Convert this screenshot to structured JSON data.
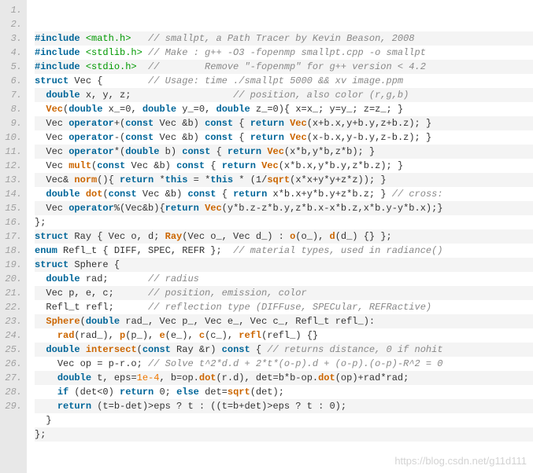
{
  "watermark": "https://blog.csdn.net/g11d111",
  "lines": [
    {
      "n": "1.",
      "pre": "",
      "tokens": [
        [
          "kw",
          "#include "
        ],
        [
          "inc",
          "<math.h>"
        ],
        [
          "plain",
          "   "
        ],
        [
          "cm",
          "// smallpt, a Path Tracer by Kevin Beason, 2008"
        ]
      ],
      "hl": true
    },
    {
      "n": "2.",
      "pre": "",
      "tokens": [
        [
          "kw",
          "#include "
        ],
        [
          "inc",
          "<stdlib.h>"
        ],
        [
          "plain",
          " "
        ],
        [
          "cm",
          "// Make : g++ -O3 -fopenmp smallpt.cpp -o smallpt"
        ]
      ]
    },
    {
      "n": "3.",
      "pre": "",
      "tokens": [
        [
          "kw",
          "#include "
        ],
        [
          "inc",
          "<stdio.h>"
        ],
        [
          "plain",
          "  "
        ],
        [
          "cm",
          "//        Remove \"-fopenmp\" for g++ version < 4.2"
        ]
      ],
      "hl": true
    },
    {
      "n": "4.",
      "pre": "",
      "tokens": [
        [
          "kw",
          "struct"
        ],
        [
          "plain",
          " Vec {        "
        ],
        [
          "cm",
          "// Usage: time ./smallpt 5000 && xv image.ppm"
        ]
      ]
    },
    {
      "n": "5.",
      "pre": "  ",
      "tokens": [
        [
          "kw",
          "double"
        ],
        [
          "plain",
          " x, y, z;                  "
        ],
        [
          "cm",
          "// position, also color (r,g,b)"
        ]
      ],
      "hl": true
    },
    {
      "n": "6.",
      "pre": "  ",
      "tokens": [
        [
          "fn",
          "Vec"
        ],
        [
          "plain",
          "("
        ],
        [
          "kw",
          "double"
        ],
        [
          "plain",
          " x_=0, "
        ],
        [
          "kw",
          "double"
        ],
        [
          "plain",
          " y_=0, "
        ],
        [
          "kw",
          "double"
        ],
        [
          "plain",
          " z_=0){ x=x_; y=y_; z=z_; }"
        ]
      ]
    },
    {
      "n": "7.",
      "pre": "  ",
      "tokens": [
        [
          "plain",
          "Vec "
        ],
        [
          "kw",
          "operator"
        ],
        [
          "plain",
          "+("
        ],
        [
          "kw",
          "const"
        ],
        [
          "plain",
          " Vec &b) "
        ],
        [
          "kw",
          "const"
        ],
        [
          "plain",
          " { "
        ],
        [
          "kw",
          "return"
        ],
        [
          "plain",
          " "
        ],
        [
          "fn",
          "Vec"
        ],
        [
          "plain",
          "(x+b.x,y+b.y,z+b.z); }"
        ]
      ],
      "hl": true
    },
    {
      "n": "8.",
      "pre": "  ",
      "tokens": [
        [
          "plain",
          "Vec "
        ],
        [
          "kw",
          "operator"
        ],
        [
          "plain",
          "-("
        ],
        [
          "kw",
          "const"
        ],
        [
          "plain",
          " Vec &b) "
        ],
        [
          "kw",
          "const"
        ],
        [
          "plain",
          " { "
        ],
        [
          "kw",
          "return"
        ],
        [
          "plain",
          " "
        ],
        [
          "fn",
          "Vec"
        ],
        [
          "plain",
          "(x-b.x,y-b.y,z-b.z); }"
        ]
      ]
    },
    {
      "n": "9.",
      "pre": "  ",
      "tokens": [
        [
          "plain",
          "Vec "
        ],
        [
          "kw",
          "operator"
        ],
        [
          "plain",
          "*("
        ],
        [
          "kw",
          "double"
        ],
        [
          "plain",
          " b) "
        ],
        [
          "kw",
          "const"
        ],
        [
          "plain",
          " { "
        ],
        [
          "kw",
          "return"
        ],
        [
          "plain",
          " "
        ],
        [
          "fn",
          "Vec"
        ],
        [
          "plain",
          "(x*b,y*b,z*b); }"
        ]
      ],
      "hl": true
    },
    {
      "n": "10.",
      "pre": "  ",
      "tokens": [
        [
          "plain",
          "Vec "
        ],
        [
          "fn",
          "mult"
        ],
        [
          "plain",
          "("
        ],
        [
          "kw",
          "const"
        ],
        [
          "plain",
          " Vec &b) "
        ],
        [
          "kw",
          "const"
        ],
        [
          "plain",
          " { "
        ],
        [
          "kw",
          "return"
        ],
        [
          "plain",
          " "
        ],
        [
          "fn",
          "Vec"
        ],
        [
          "plain",
          "(x*b.x,y*b.y,z*b.z); }"
        ]
      ]
    },
    {
      "n": "11.",
      "pre": "  ",
      "tokens": [
        [
          "plain",
          "Vec& "
        ],
        [
          "fn",
          "norm"
        ],
        [
          "plain",
          "(){ "
        ],
        [
          "kw",
          "return"
        ],
        [
          "plain",
          " *"
        ],
        [
          "kw",
          "this"
        ],
        [
          "plain",
          " = *"
        ],
        [
          "kw",
          "this"
        ],
        [
          "plain",
          " * (1/"
        ],
        [
          "fn",
          "sqrt"
        ],
        [
          "plain",
          "(x*x+y*y+z*z)); }"
        ]
      ],
      "hl": true
    },
    {
      "n": "12.",
      "pre": "  ",
      "tokens": [
        [
          "kw",
          "double"
        ],
        [
          "plain",
          " "
        ],
        [
          "fn",
          "dot"
        ],
        [
          "plain",
          "("
        ],
        [
          "kw",
          "const"
        ],
        [
          "plain",
          " Vec &b) "
        ],
        [
          "kw",
          "const"
        ],
        [
          "plain",
          " { "
        ],
        [
          "kw",
          "return"
        ],
        [
          "plain",
          " x*b.x+y*b.y+z*b.z; } "
        ],
        [
          "cm",
          "// cross:"
        ]
      ]
    },
    {
      "n": "13.",
      "pre": "  ",
      "tokens": [
        [
          "plain",
          "Vec "
        ],
        [
          "kw",
          "operator"
        ],
        [
          "plain",
          "%(Vec&b){"
        ],
        [
          "kw",
          "return"
        ],
        [
          "plain",
          " "
        ],
        [
          "fn",
          "Vec"
        ],
        [
          "plain",
          "(y*b.z-z*b.y,z*b.x-x*b.z,x*b.y-y*b.x);}"
        ]
      ],
      "hl": true
    },
    {
      "n": "14.",
      "pre": "",
      "tokens": [
        [
          "plain",
          "};"
        ]
      ]
    },
    {
      "n": "15.",
      "pre": "",
      "tokens": [
        [
          "kw",
          "struct"
        ],
        [
          "plain",
          " Ray { Vec o, d; "
        ],
        [
          "fn",
          "Ray"
        ],
        [
          "plain",
          "(Vec o_, Vec d_) : "
        ],
        [
          "fn",
          "o"
        ],
        [
          "plain",
          "(o_), "
        ],
        [
          "fn",
          "d"
        ],
        [
          "plain",
          "(d_) {} };"
        ]
      ],
      "hl": true
    },
    {
      "n": "16.",
      "pre": "",
      "tokens": [
        [
          "kw",
          "enum"
        ],
        [
          "plain",
          " Refl_t { DIFF, SPEC, REFR };  "
        ],
        [
          "cm",
          "// material types, used in radiance()"
        ]
      ]
    },
    {
      "n": "17.",
      "pre": "",
      "tokens": [
        [
          "kw",
          "struct"
        ],
        [
          "plain",
          " Sphere {"
        ]
      ],
      "hl": true
    },
    {
      "n": "18.",
      "pre": "  ",
      "tokens": [
        [
          "kw",
          "double"
        ],
        [
          "plain",
          " rad;       "
        ],
        [
          "cm",
          "// radius"
        ]
      ]
    },
    {
      "n": "19.",
      "pre": "  ",
      "tokens": [
        [
          "plain",
          "Vec p, e, c;      "
        ],
        [
          "cm",
          "// position, emission, color"
        ]
      ],
      "hl": true
    },
    {
      "n": "20.",
      "pre": "  ",
      "tokens": [
        [
          "plain",
          "Refl_t refl;      "
        ],
        [
          "cm",
          "// reflection type (DIFFuse, SPECular, REFRactive)"
        ]
      ]
    },
    {
      "n": "21.",
      "pre": "  ",
      "tokens": [
        [
          "fn",
          "Sphere"
        ],
        [
          "plain",
          "("
        ],
        [
          "kw",
          "double"
        ],
        [
          "plain",
          " rad_, Vec p_, Vec e_, Vec c_, Refl_t refl_):"
        ]
      ],
      "hl": true
    },
    {
      "n": "22.",
      "pre": "    ",
      "tokens": [
        [
          "fn",
          "rad"
        ],
        [
          "plain",
          "(rad_), "
        ],
        [
          "fn",
          "p"
        ],
        [
          "plain",
          "(p_), "
        ],
        [
          "fn",
          "e"
        ],
        [
          "plain",
          "(e_), "
        ],
        [
          "fn",
          "c"
        ],
        [
          "plain",
          "(c_), "
        ],
        [
          "fn",
          "refl"
        ],
        [
          "plain",
          "(refl_) {}"
        ]
      ]
    },
    {
      "n": "23.",
      "pre": "  ",
      "tokens": [
        [
          "kw",
          "double"
        ],
        [
          "plain",
          " "
        ],
        [
          "fn",
          "intersect"
        ],
        [
          "plain",
          "("
        ],
        [
          "kw",
          "const"
        ],
        [
          "plain",
          " Ray &r) "
        ],
        [
          "kw",
          "const"
        ],
        [
          "plain",
          " { "
        ],
        [
          "cm",
          "// returns distance, 0 if nohit"
        ]
      ],
      "hl": true
    },
    {
      "n": "24.",
      "pre": "    ",
      "tokens": [
        [
          "plain",
          "Vec op = p-r.o; "
        ],
        [
          "cm",
          "// Solve t^2*d.d + 2*t*(o-p).d + (o-p).(o-p)-R^2 = 0"
        ]
      ]
    },
    {
      "n": "25.",
      "pre": "    ",
      "tokens": [
        [
          "kw",
          "double"
        ],
        [
          "plain",
          " t, eps="
        ],
        [
          "num",
          "1e-4"
        ],
        [
          "plain",
          ", b=op."
        ],
        [
          "fn",
          "dot"
        ],
        [
          "plain",
          "(r.d), det=b*b-op."
        ],
        [
          "fn",
          "dot"
        ],
        [
          "plain",
          "(op)+rad*rad;"
        ]
      ],
      "hl": true
    },
    {
      "n": "26.",
      "pre": "    ",
      "tokens": [
        [
          "kw",
          "if"
        ],
        [
          "plain",
          " (det<0) "
        ],
        [
          "kw",
          "return"
        ],
        [
          "plain",
          " 0; "
        ],
        [
          "kw",
          "else"
        ],
        [
          "plain",
          " det="
        ],
        [
          "fn",
          "sqrt"
        ],
        [
          "plain",
          "(det);"
        ]
      ]
    },
    {
      "n": "27.",
      "pre": "    ",
      "tokens": [
        [
          "kw",
          "return"
        ],
        [
          "plain",
          " (t=b-det)>eps ? t : ((t=b+det)>eps ? t : 0);"
        ]
      ],
      "hl": true
    },
    {
      "n": "28.",
      "pre": "  ",
      "tokens": [
        [
          "plain",
          "}"
        ]
      ]
    },
    {
      "n": "29.",
      "pre": "",
      "tokens": [
        [
          "plain",
          "};"
        ]
      ],
      "hl": true
    }
  ]
}
